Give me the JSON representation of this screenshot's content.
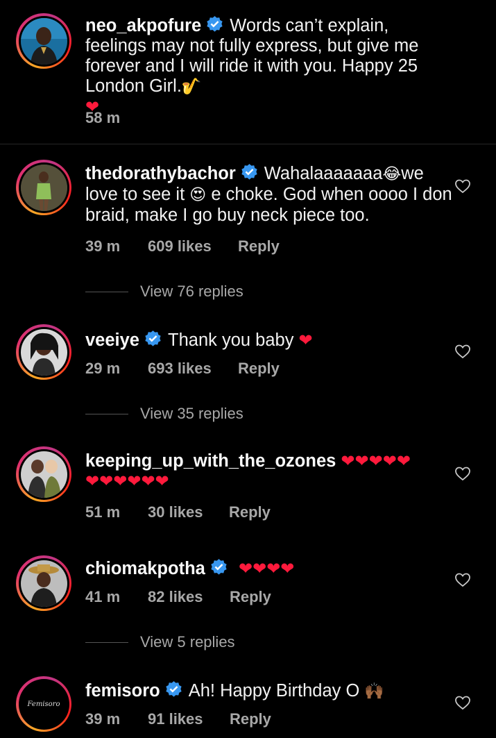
{
  "caption": {
    "username": "neo_akpofure",
    "text": "Words can’t explain, feelings may not fully express, but give me forever and I will ride it with you. Happy 25 London Girl.",
    "emoji_trailing": "🎷",
    "heart": "❤",
    "time": "58 m"
  },
  "comments": [
    {
      "username": "thedorathybachor",
      "verified": true,
      "text_a": "Wahalaaaaaaa",
      "emoji_a": "😂",
      "text_b": "we love to see it",
      "emoji_b": "😍",
      "text_c": "e choke. God when oooo I don braid, make I go buy neck piece too.",
      "time": "39 m",
      "likes": "609 likes",
      "reply": "Reply",
      "view_replies": "View 76 replies"
    },
    {
      "username": "veeiye",
      "verified": true,
      "text": "Thank you baby",
      "hearts": "❤",
      "time": "29 m",
      "likes": "693 likes",
      "reply": "Reply",
      "view_replies": "View 35 replies"
    },
    {
      "username": "keeping_up_with_the_ozones",
      "verified": false,
      "hearts_line1": "❤❤❤❤❤",
      "hearts_line2": "❤❤❤❤❤❤",
      "time": "51 m",
      "likes": "30 likes",
      "reply": "Reply"
    },
    {
      "username": "chiomakpotha",
      "verified": true,
      "hearts": "❤❤❤❤",
      "time": "41 m",
      "likes": "82 likes",
      "reply": "Reply",
      "view_replies": "View 5 replies"
    },
    {
      "username": "femisoro",
      "verified": true,
      "text": "Ah! Happy Birthday O",
      "emoji": "🙌🏾",
      "avatar_text": "Femisoro",
      "time": "39 m",
      "likes": "91 likes",
      "reply": "Reply"
    }
  ],
  "colors": {
    "background": "#000000",
    "verified": "#3897f0",
    "heart": "#ff1a3c",
    "meta": "#a8a8a8"
  }
}
